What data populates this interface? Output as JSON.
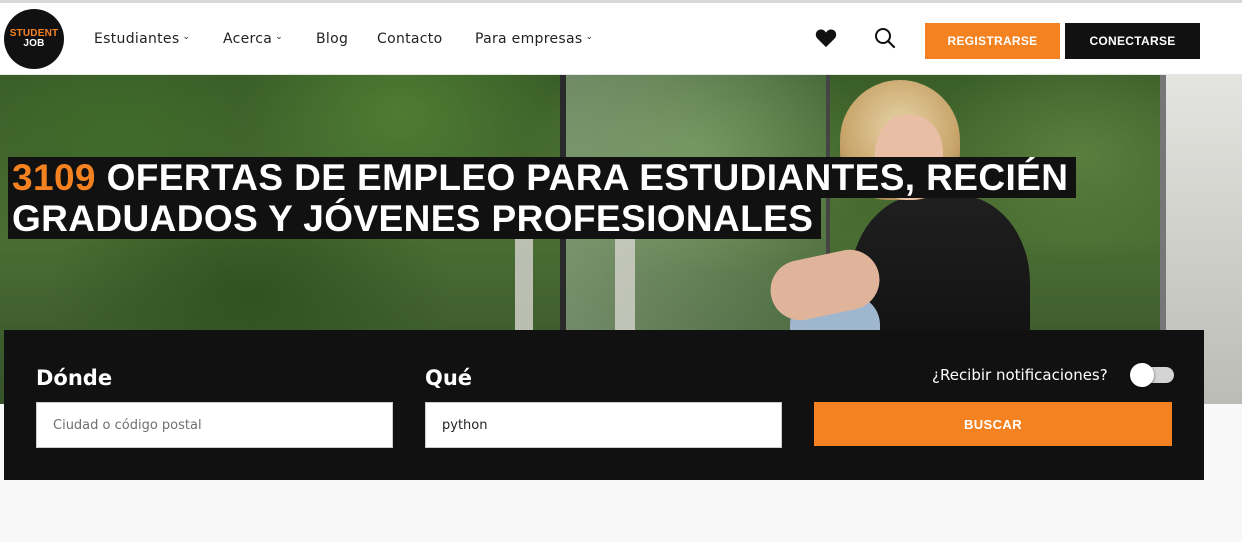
{
  "header": {
    "logo": {
      "line1": "STUDENT",
      "line2": "JOB"
    },
    "nav": [
      {
        "label": "Estudiantes",
        "has_dropdown": true
      },
      {
        "label": "Acerca",
        "has_dropdown": true
      },
      {
        "label": "Blog",
        "has_dropdown": false
      },
      {
        "label": "Contacto",
        "has_dropdown": false
      },
      {
        "label": "Para empresas",
        "has_dropdown": true
      }
    ],
    "icons": {
      "favorites": "heart-icon",
      "search": "search-icon"
    },
    "register_label": "REGISTRARSE",
    "login_label": "CONECTARSE"
  },
  "hero": {
    "count": "3109",
    "title_line1_rest": " OFERTAS DE EMPLEO PARA ESTUDIANTES, RECIÉN",
    "title_line2": "GRADUADOS Y JÓVENES PROFESIONALES"
  },
  "search": {
    "where_label": "Dónde",
    "where_placeholder": "Ciudad o código postal",
    "where_value": "",
    "what_label": "Qué",
    "what_value": "python",
    "notifications_label": "¿Recibir notificaciones?",
    "notifications_on": false,
    "submit_label": "BUSCAR"
  },
  "colors": {
    "brand_orange": "#f58220",
    "dark": "#111111",
    "white": "#ffffff"
  }
}
